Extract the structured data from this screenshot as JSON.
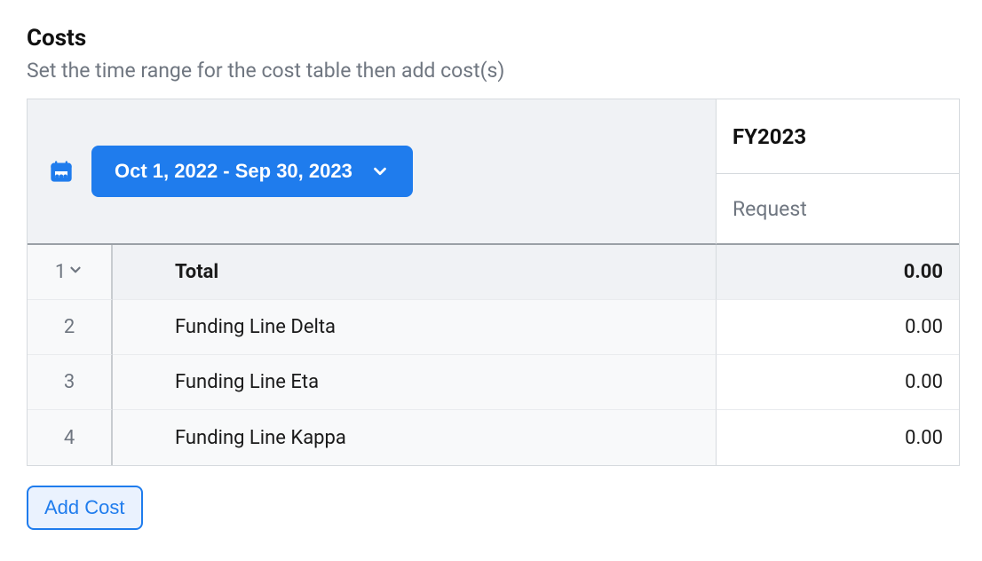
{
  "section": {
    "title": "Costs",
    "subtitle": "Set the time range for the cost table then add cost(s)"
  },
  "dateRange": {
    "label": "Oct 1, 2022 - Sep 30, 2023"
  },
  "columns": {
    "period": "FY2023",
    "subheader": "Request"
  },
  "rows": {
    "total": {
      "num": "1",
      "label": "Total",
      "value": "0.00"
    },
    "items": [
      {
        "num": "2",
        "label": "Funding Line Delta",
        "value": "0.00"
      },
      {
        "num": "3",
        "label": "Funding Line Eta",
        "value": "0.00"
      },
      {
        "num": "4",
        "label": "Funding Line Kappa",
        "value": "0.00"
      }
    ]
  },
  "actions": {
    "addCost": "Add Cost"
  }
}
